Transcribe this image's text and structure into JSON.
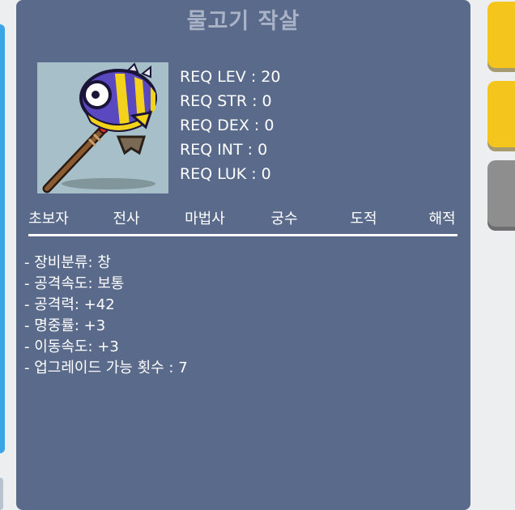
{
  "item": {
    "name": "물고기 작살",
    "icon": "fish-harpoon-icon"
  },
  "requirements": [
    "REQ LEV : 20",
    "REQ STR : 0",
    "REQ DEX : 0",
    "REQ INT : 0",
    "REQ LUK : 0"
  ],
  "jobs": [
    "초보자",
    "전사",
    "마법사",
    "궁수",
    "도적",
    "해적"
  ],
  "stats": [
    "- 장비분류: 창",
    "- 공격속도: 보통",
    "- 공격력: +42",
    "- 명중률: +3",
    "- 이동속도: +3",
    "- 업그레이드 가능 횟수 : 7"
  ],
  "colors": {
    "panel": "#5a6a8b",
    "title": "#aab3c6",
    "side_button_yellow": "#f4c51c",
    "side_button_gray": "#8e8e8e",
    "left_accent": "#3aa6e8"
  }
}
